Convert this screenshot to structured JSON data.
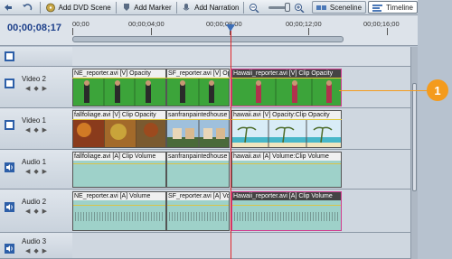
{
  "toolbar": {
    "add_dvd_scene": "Add DVD Scene",
    "add_marker": "Add Marker",
    "add_narration": "Add Narration",
    "sceneline": "Sceneline",
    "timeline": "Timeline"
  },
  "timecode": "00;00;08;17",
  "ruler_labels": [
    "00;00",
    "00;00;04;00",
    "00;00;08;00",
    "00;00;12;00",
    "00;00;16;00"
  ],
  "tracks": {
    "video2": "Video 2",
    "video1": "Video 1",
    "audio1": "Audio 1",
    "audio2": "Audio 2",
    "audio3": "Audio 3"
  },
  "clips": {
    "v2_a": "NE_reporter.avi [V] Opacity",
    "v2_b": "SF_reporter.avi [V] Opacity",
    "v2_c": "Hawaii_reporter.avi [V] Clip Opacity",
    "v1_a": "fallfoliage.avi [V] Clip Opacity",
    "v1_b": "sanfranpaintedhouse",
    "v1_c": "hawaii.avi [V] Opacity:Clip Opacity",
    "a1_a": "fallfoliage.avi [A] Clip Volume",
    "a1_b": "sanfranpaintedhouse",
    "a1_c": "hawaii.avi [A] Volume:Clip Volume",
    "a2_a": "NE_reporter.avi [A] Volume",
    "a2_b": "SF_reporter.avi [A] Volume",
    "a2_c": "Hawaii_reporter.avi [A] Clip Volume"
  },
  "callout": "1",
  "colors": {
    "accent": "#f49b1d",
    "playhead": "#e0262a",
    "timecode": "#1c3f8a",
    "selection": "#d23a8e"
  }
}
